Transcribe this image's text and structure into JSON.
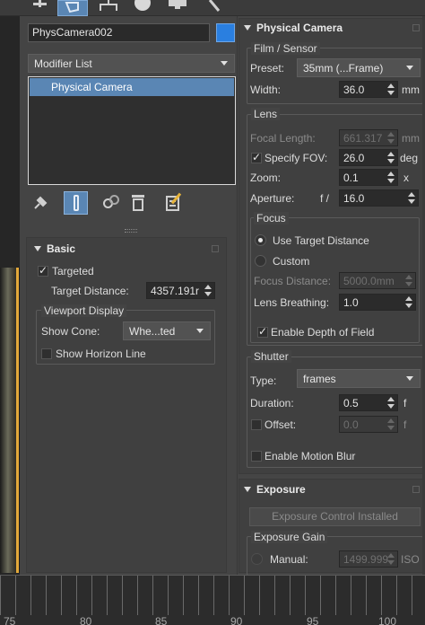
{
  "top_toolbar": {
    "icons": [
      "create-icon",
      "modify-icon",
      "hierarchy-icon",
      "motion-icon",
      "display-icon",
      "utilities-icon"
    ]
  },
  "object": {
    "name": "PhysCamera002",
    "color": "#2a7fe0"
  },
  "modifier_list": {
    "label": "Modifier List"
  },
  "stack": {
    "items": [
      "Physical Camera"
    ]
  },
  "stack_tools": {
    "icons": [
      "pin-stack-icon",
      "show-end-result-icon",
      "make-unique-icon",
      "remove-modifier-icon",
      "configure-modifier-sets-icon"
    ]
  },
  "basic": {
    "title": "Basic",
    "targeted": "Targeted",
    "target_distance_label": "Target Distance:",
    "target_distance": "4357.191r",
    "viewport_display": {
      "title": "Viewport Display",
      "show_cone_label": "Show Cone:",
      "show_cone": "Whe...ted",
      "show_horizon": "Show Horizon Line"
    }
  },
  "physical_camera": {
    "title": "Physical Camera",
    "film": {
      "title": "Film / Sensor",
      "preset_label": "Preset:",
      "preset": "35mm (...Frame)",
      "width_label": "Width:",
      "width": "36.0",
      "width_unit": "mm"
    },
    "lens": {
      "title": "Lens",
      "focal_label": "Focal Length:",
      "focal": "661.317",
      "focal_unit": "mm",
      "fov_label": "Specify FOV:",
      "fov": "26.0",
      "fov_unit": "deg",
      "zoom_label": "Zoom:",
      "zoom": "0.1",
      "zoom_unit": "x",
      "aperture_label": "Aperture:",
      "aperture_prefix": "f /",
      "aperture": "16.0",
      "focus": {
        "title": "Focus",
        "use_target": "Use Target Distance",
        "custom": "Custom",
        "focus_distance_label": "Focus Distance:",
        "focus_distance": "5000.0mm",
        "breathing_label": "Lens Breathing:",
        "breathing": "1.0",
        "dof": "Enable Depth of Field"
      }
    },
    "shutter": {
      "title": "Shutter",
      "type_label": "Type:",
      "type": "frames",
      "duration_label": "Duration:",
      "duration": "0.5",
      "duration_unit": "f",
      "offset_label": "Offset:",
      "offset": "0.0",
      "offset_unit": "f",
      "motion_blur": "Enable Motion Blur"
    }
  },
  "exposure": {
    "title": "Exposure",
    "button": "Exposure Control Installed",
    "gain_title": "Exposure Gain",
    "manual_label": "Manual:",
    "manual": "1499.999",
    "manual_unit": "ISO"
  },
  "timeline": {
    "ticks": [
      "75",
      "80",
      "85",
      "90",
      "95",
      "100"
    ]
  }
}
